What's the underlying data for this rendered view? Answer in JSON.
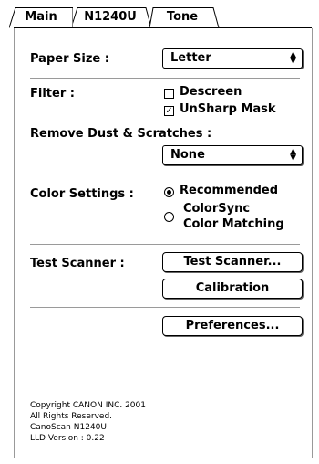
{
  "tabs": [
    {
      "label": "Main",
      "active": false
    },
    {
      "label": "N1240U",
      "active": true
    },
    {
      "label": "Tone",
      "active": false
    }
  ],
  "paper_size": {
    "label": "Paper Size :",
    "value": "Letter"
  },
  "filter": {
    "label": "Filter :",
    "options": [
      {
        "label": "Descreen",
        "checked": false
      },
      {
        "label": "UnSharp Mask",
        "checked": true
      }
    ]
  },
  "remove_dust": {
    "label": "Remove Dust & Scratches :",
    "value": "None"
  },
  "color_settings": {
    "label": "Color Settings :",
    "options": [
      {
        "label": "Recommended",
        "selected": true
      },
      {
        "label_line1": "ColorSync",
        "label_line2": "Color Matching",
        "selected": false
      }
    ]
  },
  "test_scanner": {
    "label": "Test Scanner :",
    "test_button": "Test Scanner...",
    "calibration_button": "Calibration"
  },
  "preferences_button": "Preferences...",
  "footer": {
    "lines": [
      "Copyright CANON INC. 2001",
      "All Rights Reserved.",
      "CanoScan N1240U",
      "LLD Version : 0.22"
    ]
  },
  "colors": {
    "border": "#999999",
    "divider": "#9a9a9a",
    "background": "#ffffff"
  }
}
